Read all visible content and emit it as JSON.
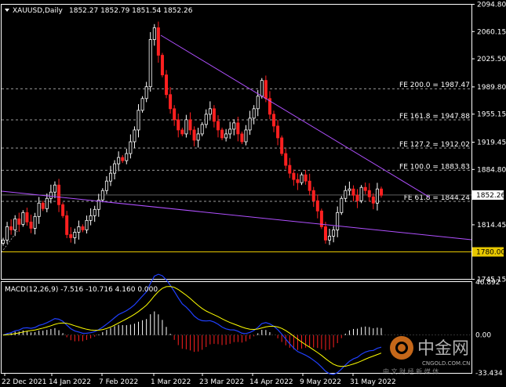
{
  "header": {
    "symbol": "XAUUSD,Daily",
    "ohlc": "1852.27 1852.79 1851.54 1852.26"
  },
  "price_axis": {
    "ticks": [
      "2094.80",
      "2060.15",
      "2025.50",
      "1989.80",
      "1955.15",
      "1919.45",
      "1884.80",
      "1814.45",
      "1745.15"
    ],
    "current_price_label": "1852.26",
    "support_label": "1780.00"
  },
  "fib_levels": [
    {
      "label": "FE 200.0 = 1987.47",
      "price": 1987.47
    },
    {
      "label": "FE 161.8 = 1947.88",
      "price": 1947.88
    },
    {
      "label": "FE 127.2 = 1912.02",
      "price": 1912.02
    },
    {
      "label": "FE 100.0 = 1883.83",
      "price": 1883.83
    },
    {
      "label": "FE 61.8 = 1844.24",
      "price": 1844.24
    }
  ],
  "macd": {
    "label": "MACD(12,26,9) -7.516 -10.716 4.160 0.000",
    "ticks": [
      "46.892",
      "0.00",
      "-33.434"
    ]
  },
  "time_axis": [
    "22 Dec 2021",
    "14 Jan 2022",
    "7 Feb 2022",
    "1 Mar 2022",
    "23 Mar 2022",
    "14 Apr 2022",
    "9 May 2022",
    "31 May 2022"
  ],
  "watermark": {
    "brand": "中金网",
    "domain": "CNGOLD.COM.CN",
    "tagline": "中 文 财 经 新 媒 体"
  },
  "colors": {
    "up": "#ffffff",
    "down": "#ff2020",
    "trendline": "#b050ff",
    "support": "#e8c800",
    "signal": "#ffff00",
    "macd_line": "#2040ff"
  },
  "chart_data": {
    "type": "candlestick",
    "title": "XAUUSD,Daily",
    "ylim": [
      1745.15,
      2094.8
    ],
    "support_price": 1780.0,
    "current_price": 1852.26,
    "price_path": [
      1795,
      1812,
      1808,
      1822,
      1815,
      1830,
      1818,
      1810,
      1825,
      1842,
      1835,
      1848,
      1856,
      1865,
      1840,
      1826,
      1802,
      1798,
      1805,
      1812,
      1808,
      1820,
      1826,
      1834,
      1846,
      1858,
      1870,
      1880,
      1892,
      1900,
      1896,
      1905,
      1920,
      1935,
      1960,
      1975,
      1990,
      2050,
      2065,
      2030,
      2005,
      1980,
      1962,
      1948,
      1935,
      1930,
      1948,
      1935,
      1922,
      1930,
      1942,
      1955,
      1962,
      1946,
      1935,
      1925,
      1930,
      1936,
      1944,
      1930,
      1920,
      1935,
      1950,
      1962,
      1978,
      1998,
      1975,
      1955,
      1940,
      1925,
      1905,
      1890,
      1880,
      1872,
      1868,
      1878,
      1870,
      1858,
      1845,
      1832,
      1812,
      1795,
      1800,
      1808,
      1830,
      1848,
      1858,
      1860,
      1852,
      1845,
      1862,
      1858,
      1850,
      1842,
      1860,
      1852
    ]
  }
}
